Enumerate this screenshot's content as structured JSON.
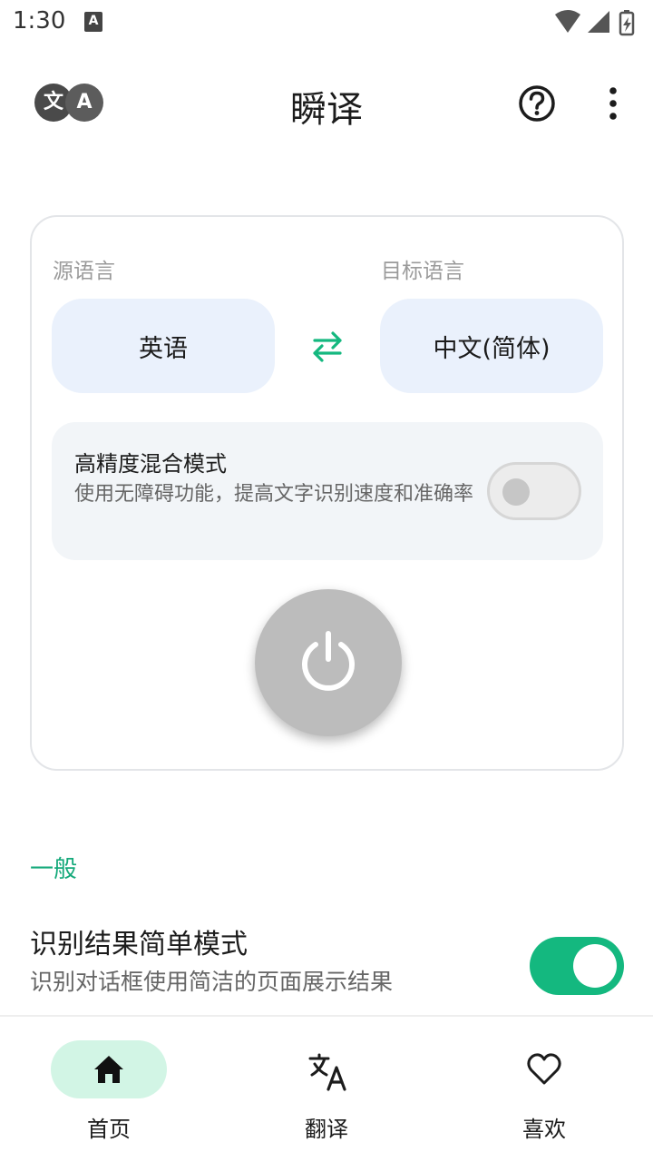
{
  "status_bar": {
    "time": "1:30",
    "notification_letter": "A"
  },
  "app_bar": {
    "title": "瞬译",
    "logo_left_char": "文",
    "logo_right_char": "A",
    "help_icon": "help-circle-icon",
    "more_icon": "more-vertical-icon"
  },
  "translator_card": {
    "source_label": "源语言",
    "target_label": "目标语言",
    "source_language": "英语",
    "target_language": "中文(简体)",
    "swap_icon": "swap-arrows-icon",
    "high_precision": {
      "title": "高精度混合模式",
      "description": "使用无障碍功能，提高文字识别速度和准确率",
      "enabled": false
    },
    "power_icon": "power-icon"
  },
  "general_section": {
    "title": "一般",
    "simple_mode": {
      "title": "识别结果简单模式",
      "description": "识别对话框使用简洁的页面展示结果",
      "enabled": true
    }
  },
  "bottom_nav": {
    "items": [
      {
        "label": "首页",
        "icon": "home-icon",
        "active": true
      },
      {
        "label": "翻译",
        "icon": "translate-icon",
        "active": false
      },
      {
        "label": "喜欢",
        "icon": "heart-icon",
        "active": false
      }
    ]
  },
  "colors": {
    "accent": "#14b87f",
    "section_title": "#14a97a",
    "lang_button_bg": "#eaf1fc",
    "row_bg": "#f2f5f8",
    "power_button": "#bcbcbc",
    "nav_active_pill": "#d2f5e5"
  }
}
